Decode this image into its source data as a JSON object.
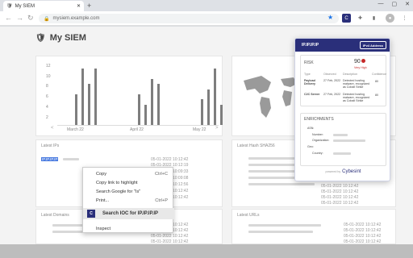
{
  "browser": {
    "tab_title": "My SIEM",
    "url": "mysiem.example.com",
    "new_tab": "+"
  },
  "app": {
    "title": "My SIEM"
  },
  "chart": {
    "labels": [
      "March 22",
      "April 22",
      "May 22"
    ],
    "yticks": [
      "12",
      "10",
      "8",
      "6",
      "4",
      "2"
    ],
    "nav_prev": "<",
    "nav_next": ">"
  },
  "chart_data": {
    "type": "bar",
    "categories": [
      "March 22",
      "April 22",
      "May 22"
    ],
    "ylim": [
      0,
      12
    ],
    "series": [
      {
        "values": [
          6,
          11,
          8,
          11,
          6,
          4,
          9,
          8,
          5,
          7,
          11,
          4
        ]
      }
    ]
  },
  "cards": {
    "latest_ips": "Latest IPs",
    "latest_hash": "Latest Hash SHA256",
    "latest_domains": "Latest Domains",
    "latest_urls": "Latest URLs"
  },
  "ips_rows": [
    {
      "ip": "IP.IP.IP.IP",
      "date": "05-01-2022 10:12:42"
    },
    {
      "date": "05-01-2022 10:12:19"
    },
    {
      "date": "05-01-2022 10:09:33"
    },
    {
      "date": "05-01-2022 10:09:08"
    },
    {
      "date": "05-01-2022 10:12:56"
    },
    {
      "date": "05-01-2022 10:12:42"
    },
    {
      "date": "05-01-2022 10:12:42"
    }
  ],
  "hash_rows": [
    "05-01-2022 10:12:42",
    "05-01-2022 10:12:42",
    "05-01-2022 10:12:42",
    "05-01-2022 10:12:42",
    "05-01-2022 10:12:42"
  ],
  "domain_rows": [
    "05-01-2022 10:12:42",
    "05-01-2022 10:12:42",
    "05-01-2022 10:12:42",
    "05-01-2022 10:12:42"
  ],
  "url_rows": [
    "05-01-2022 10:12:42",
    "05-01-2022 10:12:42",
    "05-01-2022 10:12:42",
    "05-01-2022 10:12:42"
  ],
  "context_menu": {
    "copy": "Copy",
    "copy_short": "Ctrl+C",
    "copy_link": "Copy link to highlight",
    "search_google": "Search Google for \"Is\"",
    "print": "Print...",
    "print_short": "Ctrl+P",
    "search_ioc": "Search IOC for IP.IP.IP.IP",
    "inspect": "Inspect"
  },
  "cybersixgill": {
    "ip": "IP.IP.IP.IP",
    "type_badge": "IPv4 Address",
    "risk_label": "RISK",
    "risk_score": "90",
    "risk_level": "Very High",
    "cols": [
      "Type",
      "Observed",
      "Description",
      "Confidence"
    ],
    "rows": [
      {
        "type": "Payload Delivery",
        "observed": "27 Feb, 2022",
        "desc": "Detected hosting malware, recognized as Cobalt Strike",
        "conf": "80"
      },
      {
        "type": "C2C Server",
        "observed": "27 Feb, 2022",
        "desc": "Detected hosting malware, recognized as Cobalt Strike",
        "conf": "80"
      }
    ],
    "enrich_label": "ENRICHMENTS",
    "asn": "ASN:",
    "number": "Number:",
    "organization": "Organization:",
    "geo": "Geo:",
    "country": "Country:",
    "powered": "powered by",
    "brand": "Cybesint"
  },
  "colors": {
    "accent": "#2a2f7a",
    "risk": "#c62828"
  }
}
